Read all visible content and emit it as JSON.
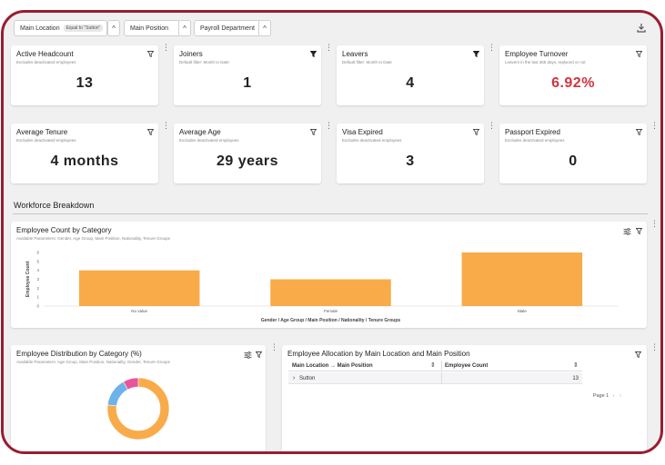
{
  "filters": [
    {
      "label": "Main Location",
      "tag": "Equal to \"Sutton\""
    },
    {
      "label": "Main Position",
      "tag": ""
    },
    {
      "label": "Payroll Department",
      "tag": ""
    }
  ],
  "kpis": [
    {
      "title": "Active Headcount",
      "subtitle": "Excludes deactivated employees",
      "value": "13"
    },
    {
      "title": "Joiners",
      "subtitle": "Default filter: Month to Date",
      "value": "1"
    },
    {
      "title": "Leavers",
      "subtitle": "Default filter: Month to Date",
      "value": "4"
    },
    {
      "title": "Employee Turnover",
      "subtitle": "Leavers in the last 365 days, replaced or not",
      "value": "6.92%"
    },
    {
      "title": "Average Tenure",
      "subtitle": "Excludes deactivated employees",
      "value": "4 months"
    },
    {
      "title": "Average Age",
      "subtitle": "Excludes deactivated employees",
      "value": "29 years"
    },
    {
      "title": "Visa Expired",
      "subtitle": "Excludes deactivated employees",
      "value": "3"
    },
    {
      "title": "Passport Expired",
      "subtitle": "Excludes deactivated employees",
      "value": "0"
    }
  ],
  "section": {
    "title": "Workforce Breakdown"
  },
  "category_chart": {
    "title": "Employee Count by Category",
    "subtitle": "Available Parameters: Gender, Age Group, Main Position, Nationality, Tenure Groups"
  },
  "distribution_panel": {
    "title": "Employee Distribution by Category (%)",
    "subtitle": "Available Parameters: Age Group, Main Position, Nationality, Gender, Tenure Groups"
  },
  "allocation_panel": {
    "title": "Employee Allocation by Main Location and Main Position",
    "columns": [
      "Main Location → Main Position",
      "Employee Count"
    ],
    "rows": [
      {
        "label": "Sutton",
        "count": "13"
      }
    ],
    "pager": "Page 1"
  },
  "colors": {
    "accent": "#9b1c30",
    "bar": "#f9ab4a",
    "donut": [
      "#f9ab4a",
      "#6eb2ea",
      "#e8559a"
    ],
    "turnover": "#d0343f"
  },
  "chart_data": [
    {
      "type": "bar",
      "title": "Employee Count by Category",
      "categories": [
        "No value",
        "Female",
        "Male"
      ],
      "values": [
        4,
        3,
        6
      ],
      "xlabel": "Gender / Age Group / Main Position / Nationality / Tenure Groups",
      "ylabel": "Employee Count",
      "ylim": [
        0,
        6
      ],
      "yticks": [
        0,
        1,
        2,
        3,
        4,
        5,
        6
      ],
      "grid": false
    },
    {
      "type": "pie",
      "title": "Employee Distribution by Category (%)",
      "values": [
        77,
        15,
        8
      ]
    }
  ]
}
